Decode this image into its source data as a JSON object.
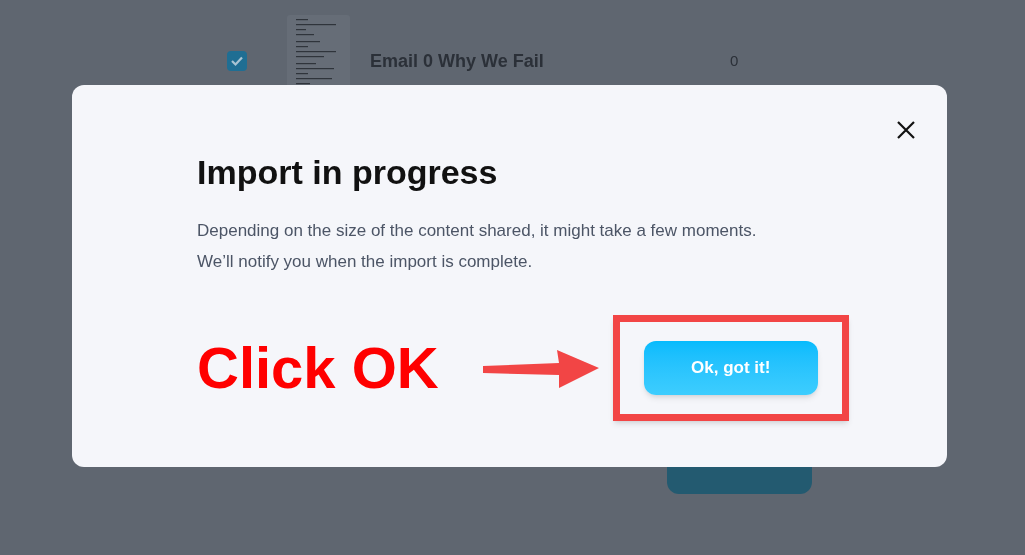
{
  "background_row": {
    "checked": true,
    "title": "Email 0 Why We Fail",
    "count": "0"
  },
  "dialog": {
    "title": "Import in progress",
    "message": "Depending on the size of the content shared, it might take a few moments. We’ll notify you when the import is complete.",
    "button": "Ok, got it!"
  },
  "annotation": {
    "text": "Click OK"
  }
}
